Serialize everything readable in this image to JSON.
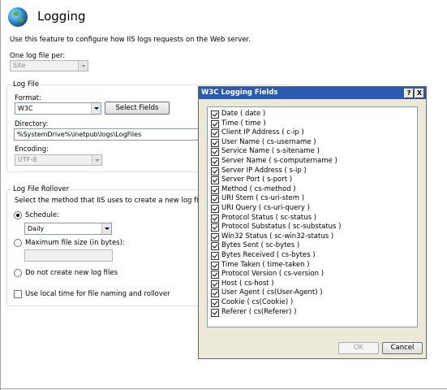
{
  "page": {
    "title": "Logging",
    "description": "Use this feature to configure how IIS logs requests on the Web server.",
    "one_log_file_label": "One log file per:",
    "one_log_file_value": "Site"
  },
  "log_file": {
    "group_label": "Log File",
    "format_label": "Format:",
    "format_value": "W3C",
    "select_fields_button": "Select Fields",
    "directory_label": "Directory:",
    "directory_value": "%SystemDrive%\\inetpub\\logs\\LogFiles",
    "encoding_label": "Encoding:",
    "encoding_value": "UTF-8"
  },
  "rollover": {
    "group_label": "Log File Rollover",
    "description": "Select the method that IIS uses to create a new log file.",
    "schedule_label": "Schedule:",
    "schedule_value": "Daily",
    "max_size_label": "Maximum file size (in bytes):",
    "no_new_label": "Do not create new log files",
    "local_time_label": "Use local time for file naming and rollover"
  },
  "dialog": {
    "title": "W3C Logging Fields",
    "help_btn": "?",
    "close_btn": "X",
    "ok_button": "OK",
    "cancel_button": "Cancel",
    "fields": [
      "Date ( date )",
      "Time ( time )",
      "Client IP Address ( c-ip )",
      "User Name ( cs-username )",
      "Service Name ( s-sitename )",
      "Server Name ( s-computername )",
      "Server IP Address ( s-ip )",
      "Server Port ( s-port )",
      "Method ( cs-method )",
      "URI Stem ( cs-uri-stem )",
      "URI Query ( cs-uri-query )",
      "Protocol Status ( sc-status )",
      "Protocol Substatus ( sc-substatus )",
      "Win32 Status ( sc-win32-status )",
      "Bytes Sent ( sc-bytes )",
      "Bytes Received ( cs-bytes )",
      "Time Taken ( time-taken )",
      "Protocol Version ( cs-version )",
      "Host ( cs-host )",
      "User Agent ( cs(User-Agent) )",
      "Cookie ( cs(Cookie) )",
      "Referer ( cs(Referer) )"
    ]
  }
}
